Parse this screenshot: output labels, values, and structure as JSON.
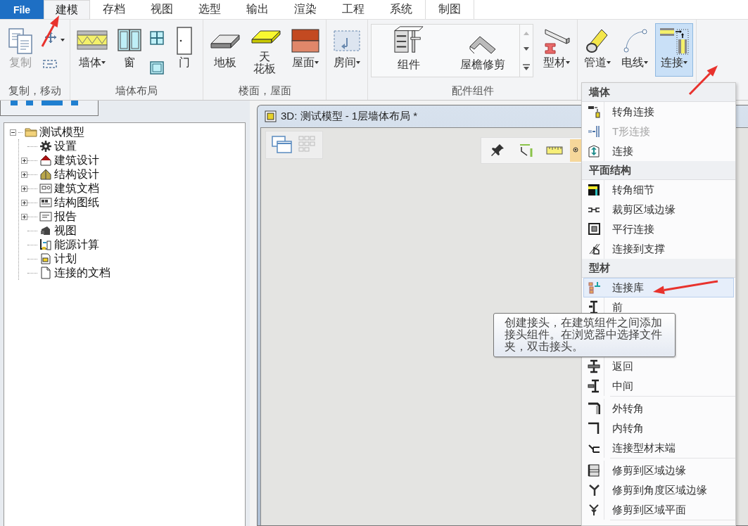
{
  "tabs": [
    {
      "label": "File",
      "kind": "file",
      "selected": false
    },
    {
      "label": "建模",
      "kind": "tab",
      "selected": true
    },
    {
      "label": "存档",
      "kind": "tab",
      "selected": false
    },
    {
      "label": "视图",
      "kind": "tab",
      "selected": false
    },
    {
      "label": "选型",
      "kind": "tab",
      "selected": false
    },
    {
      "label": "输出",
      "kind": "tab",
      "selected": false
    },
    {
      "label": "渲染",
      "kind": "tab",
      "selected": false
    },
    {
      "label": "工程",
      "kind": "tab",
      "selected": false
    },
    {
      "label": "系统",
      "kind": "tab",
      "selected": false
    },
    {
      "label": "制图",
      "kind": "tab",
      "selected": false
    }
  ],
  "ribbon": {
    "groups": [
      {
        "label": "复制，移动",
        "items": [
          {
            "label": "复制",
            "dropdown": false,
            "disabled": true,
            "selected": false
          },
          {
            "dropdown": true,
            "disabled": false,
            "selected": false
          },
          {
            "dropdown": false,
            "disabled": false,
            "selected": false
          }
        ]
      },
      {
        "label": "墙体布局",
        "items": [
          {
            "label": "墙体",
            "dropdown": true,
            "disabled": false,
            "selected": false
          },
          {
            "label": "窗",
            "dropdown": false,
            "disabled": false,
            "selected": false
          },
          {
            "dropdown": false,
            "disabled": false,
            "selected": false
          },
          {
            "dropdown": false,
            "disabled": false,
            "selected": false
          },
          {
            "label": "门",
            "dropdown": false,
            "disabled": false,
            "selected": false
          }
        ]
      },
      {
        "label": "楼面，屋面",
        "items": [
          {
            "label": "地板",
            "dropdown": false,
            "disabled": false,
            "selected": false
          },
          {
            "label": "天花板",
            "wrapped": true,
            "dropdown": false,
            "disabled": false,
            "selected": false
          },
          {
            "label": "屋面",
            "dropdown": true,
            "disabled": false,
            "selected": false
          }
        ]
      },
      {
        "items": [
          {
            "label": "房间",
            "dropdown": true,
            "disabled": false,
            "selected": false
          }
        ]
      },
      {
        "label": "配件组件",
        "gallery": [
          {
            "label": "组件"
          },
          {
            "label": "屋檐修剪"
          }
        ],
        "items": [
          {
            "label": "型材",
            "dropdown": true,
            "disabled": false,
            "selected": false
          }
        ]
      },
      {
        "items": [
          {
            "label": "管道",
            "dropdown": true,
            "disabled": false,
            "selected": false
          },
          {
            "label": "电线",
            "dropdown": true,
            "disabled": false,
            "selected": false
          },
          {
            "label": "连接",
            "dropdown": true,
            "disabled": false,
            "selected": true
          }
        ]
      }
    ]
  },
  "tree": [
    {
      "label": "测试模型",
      "expanded": true,
      "children": [
        {
          "label": "设置"
        },
        {
          "label": "建筑设计",
          "expanded": false
        },
        {
          "label": "结构设计",
          "expanded": false
        },
        {
          "label": "建筑文档",
          "expanded": false
        },
        {
          "label": "结构图纸",
          "expanded": false
        },
        {
          "label": "报告",
          "expanded": false
        },
        {
          "label": "视图"
        },
        {
          "label": "能源计算"
        },
        {
          "label": "计划"
        },
        {
          "label": "连接的文档"
        }
      ]
    }
  ],
  "document": {
    "title": "3D: 测试模型 - 1层墙体布局 *",
    "view_tools": [
      {
        "selected": false
      },
      {
        "selected": false
      },
      {
        "selected": false
      },
      {
        "selected": true
      }
    ]
  },
  "menu": {
    "sections": [
      {
        "title": "墙体",
        "items": [
          {
            "kind": "item",
            "label": "转角连接",
            "disabled": false,
            "selected": false
          },
          {
            "kind": "item",
            "label": "T形连接",
            "disabled": true,
            "selected": false
          },
          {
            "kind": "item",
            "label": "连接",
            "disabled": false,
            "selected": false
          }
        ]
      },
      {
        "title": "平面结构",
        "items": [
          {
            "kind": "item",
            "label": "转角细节",
            "disabled": false,
            "selected": false
          },
          {
            "kind": "item",
            "label": "裁剪区域边缘",
            "disabled": false,
            "selected": false
          },
          {
            "kind": "item",
            "label": "平行连接",
            "disabled": false,
            "selected": false
          },
          {
            "kind": "item",
            "label": "连接到支撑",
            "disabled": false,
            "selected": false
          }
        ]
      },
      {
        "title": "型材",
        "items": [
          {
            "kind": "item",
            "label": "连接库",
            "disabled": false,
            "selected": true
          },
          {
            "kind": "item",
            "label": "前",
            "disabled": false,
            "selected": false
          },
          {
            "kind": "covered"
          },
          {
            "kind": "covered"
          },
          {
            "kind": "item",
            "label": "返回",
            "disabled": false,
            "selected": false
          },
          {
            "kind": "item",
            "label": "中间",
            "disabled": false,
            "selected": false
          },
          {
            "kind": "separator"
          },
          {
            "kind": "item",
            "label": "外转角",
            "disabled": false,
            "selected": false
          },
          {
            "kind": "item",
            "label": "内转角",
            "disabled": false,
            "selected": false
          },
          {
            "kind": "item",
            "label": "连接型材末端",
            "disabled": false,
            "selected": false
          },
          {
            "kind": "separator"
          },
          {
            "kind": "item",
            "label": "修剪到区域边缘",
            "disabled": false,
            "selected": false
          },
          {
            "kind": "item",
            "label": "修剪到角度区域边缘",
            "disabled": false,
            "selected": false
          },
          {
            "kind": "item",
            "label": "修剪到区域平面",
            "disabled": false,
            "selected": false
          },
          {
            "kind": "separator"
          }
        ]
      }
    ]
  },
  "tooltip": {
    "text": "创建接头，在建筑组件之间添加接头组件。在浏览器中选择文件夹，双击接头。"
  }
}
